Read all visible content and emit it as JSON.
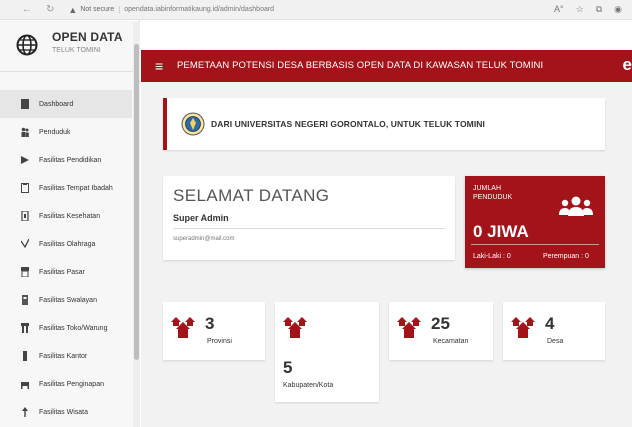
{
  "browser": {
    "security_label": "Not secure",
    "url": "opendata.iabinformatikaung.id/admin/dashboard",
    "icon_names": [
      "back-icon",
      "reload-icon",
      "lock-icon",
      "read-aloud-icon",
      "favorites-icon",
      "collections-icon",
      "profile-icon"
    ]
  },
  "brand": {
    "title": "OPEN DATA",
    "subtitle": "TELUK TOMINI",
    "logo_icon": "globe-icon"
  },
  "sidebar": {
    "items": [
      {
        "label": "Dashboard",
        "icon": "dashboard-icon",
        "active": true
      },
      {
        "label": "Penduduk",
        "icon": "people-icon",
        "active": false
      },
      {
        "label": "Fasilitas Pendidikan",
        "icon": "school-icon",
        "active": false
      },
      {
        "label": "Fasilitas Tempat Ibadah",
        "icon": "mosque-icon",
        "active": false
      },
      {
        "label": "Fasilitas Kesehatan",
        "icon": "hospital-icon",
        "active": false
      },
      {
        "label": "Fasilitas Olahraga",
        "icon": "sport-icon",
        "active": false
      },
      {
        "label": "Fasilitas Pasar",
        "icon": "market-icon",
        "active": false
      },
      {
        "label": "Fasilitas Swalayan",
        "icon": "store-icon",
        "active": false
      },
      {
        "label": "Fasilitas Toko/Warung",
        "icon": "shop-icon",
        "active": false
      },
      {
        "label": "Fasilitas Kantor",
        "icon": "building-icon",
        "active": false
      },
      {
        "label": "Fasilitas Penginapan",
        "icon": "hotel-icon",
        "active": false
      },
      {
        "label": "Fasilitas Wisata",
        "icon": "tour-icon",
        "active": false
      }
    ]
  },
  "header": {
    "title": "PEMETAAN POTENSI DESA BERBASIS OPEN DATA DI KAWASAN TELUK TOMINI",
    "menu_icon": "hamburger-icon",
    "user_icon": "user-icon"
  },
  "banner": {
    "text": "DARI UNIVERSITAS NEGERI GORONTALO, UNTUK TELUK TOMINI",
    "logo_icon": "university-seal-icon"
  },
  "welcome": {
    "title": "SELAMAT DATANG",
    "name": "Super Admin",
    "email": "superadmin@mail.com"
  },
  "population": {
    "label": "JUMLAH PENDUDUK",
    "value": "0 JIWA",
    "male": "Laki-Laki : 0",
    "female": "Perempuan : 0",
    "icon": "users-group-icon"
  },
  "stats": [
    {
      "value": "3",
      "label": "Provinsi",
      "icon": "houses-icon"
    },
    {
      "value": "5",
      "label": "Kabupaten/Kota",
      "icon": "houses-icon"
    },
    {
      "value": "25",
      "label": "Kecamatan",
      "icon": "houses-icon"
    },
    {
      "value": "4",
      "label": "Desa",
      "icon": "houses-icon"
    }
  ],
  "colors": {
    "accent": "#a3131a",
    "sidebar_bg": "#f7f7f7",
    "content_bg": "#f2f2f2"
  }
}
